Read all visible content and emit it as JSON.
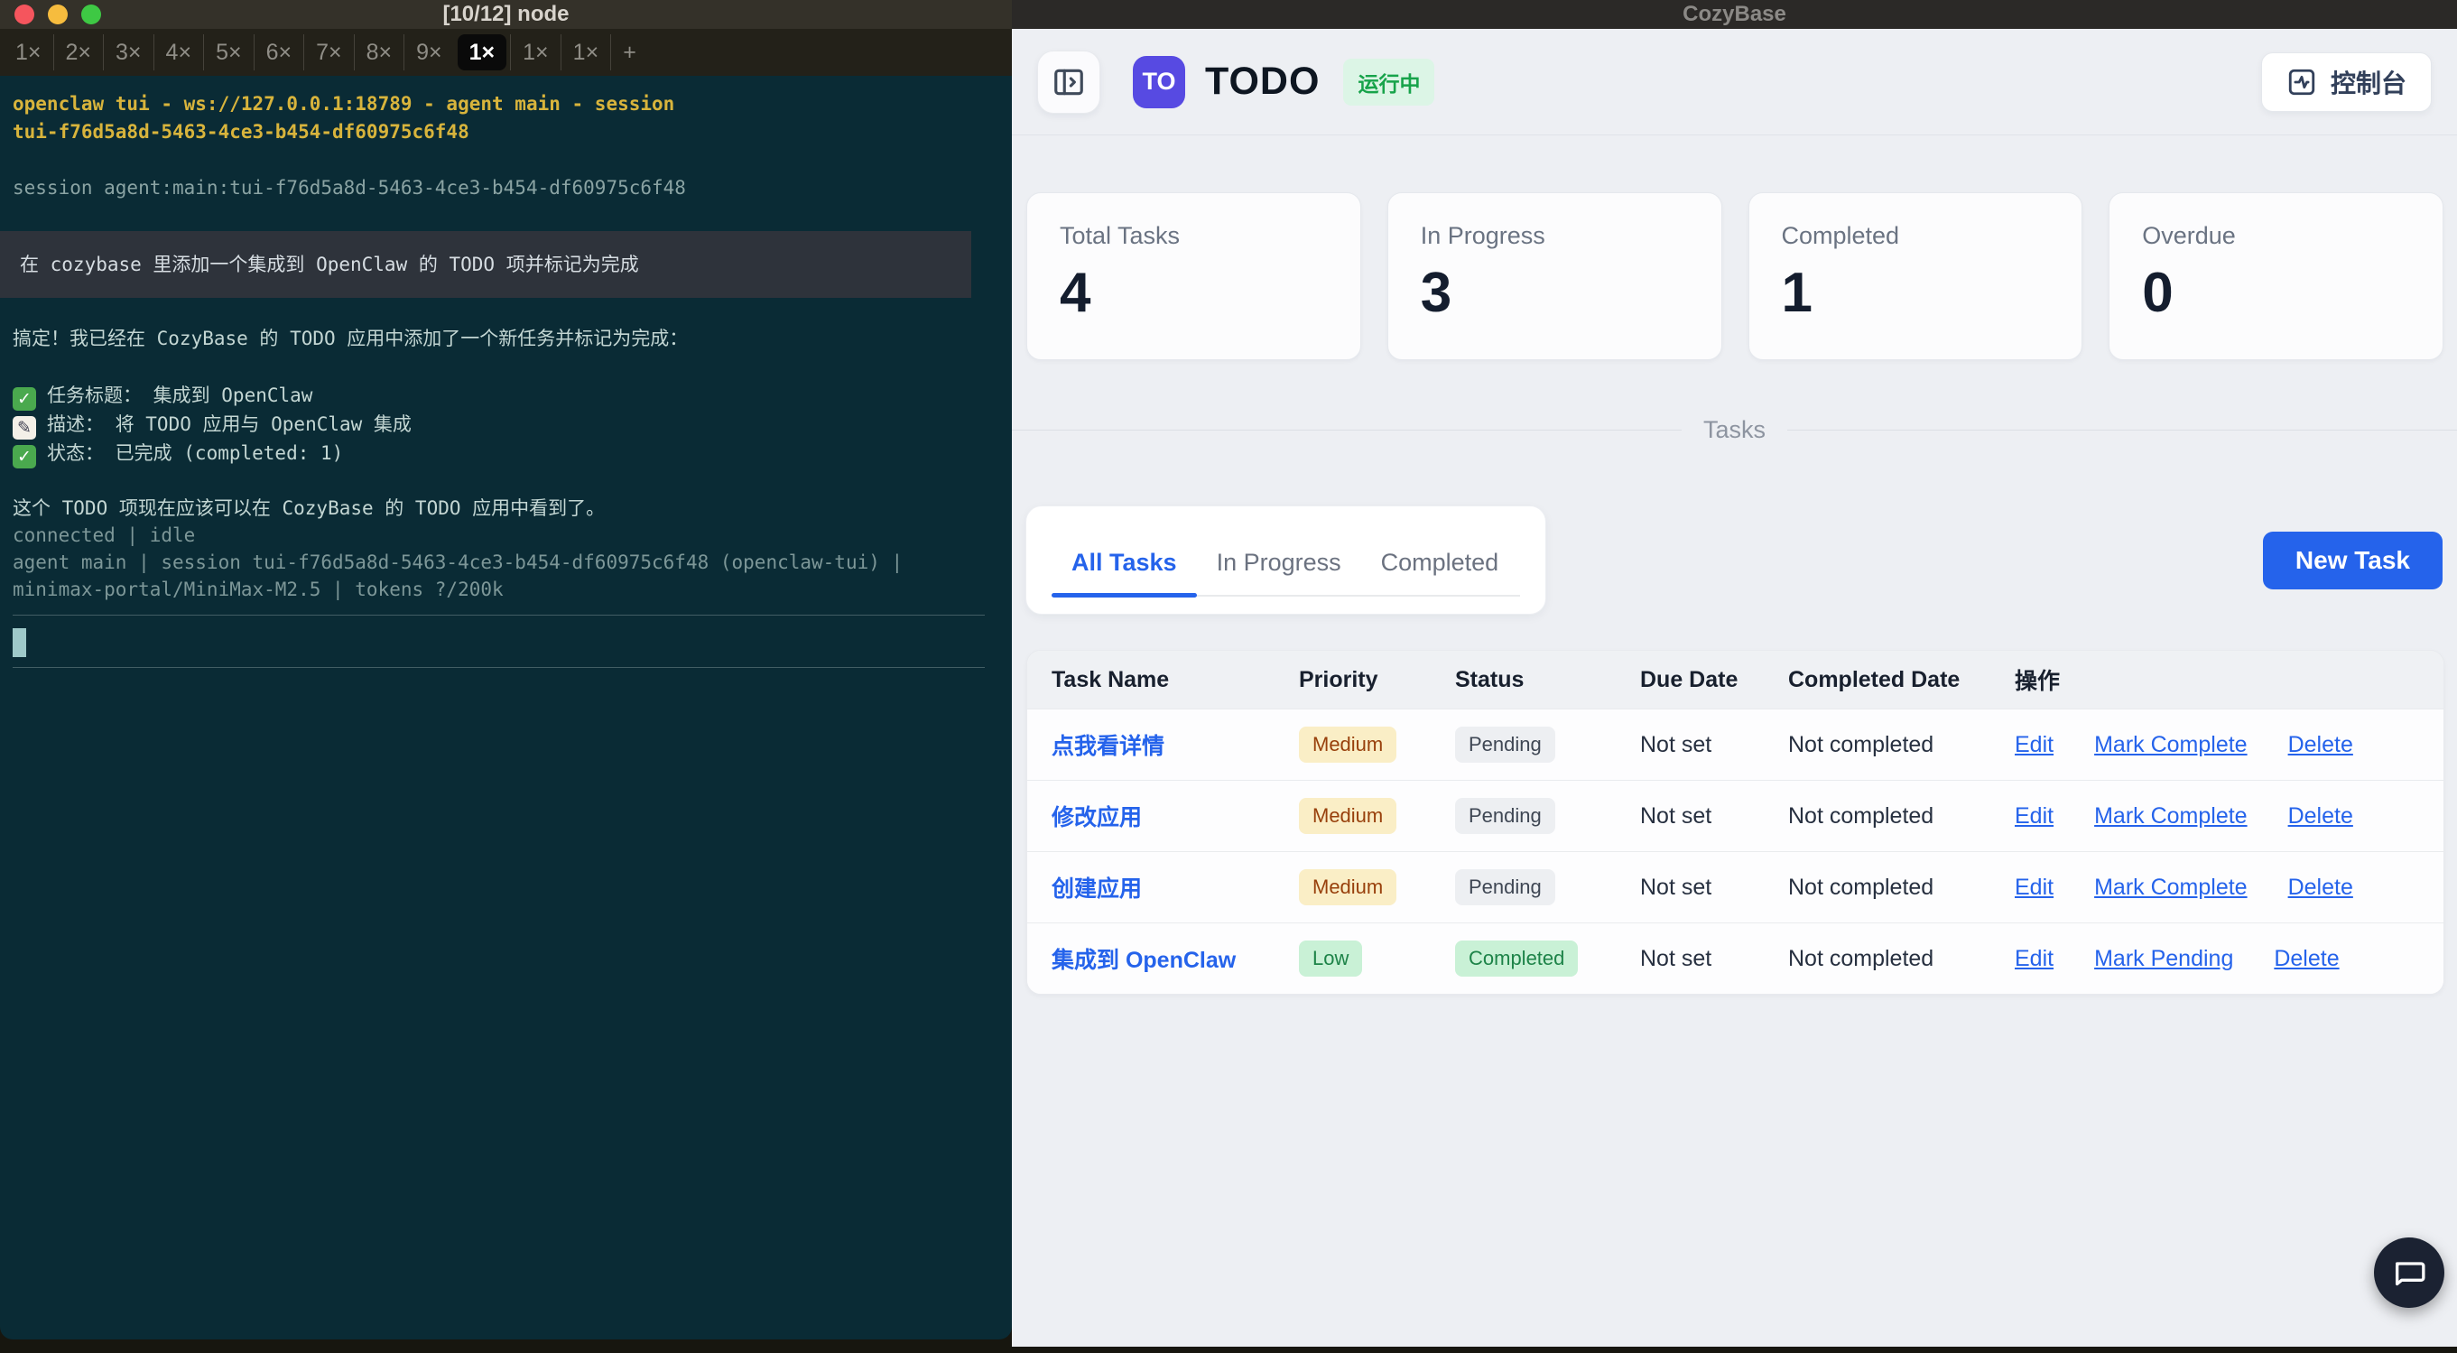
{
  "colors": {
    "accent_blue": "#2563eb",
    "logo_indigo": "#574ae2",
    "run_badge_bg": "#dcf5e6",
    "run_badge_text": "#17a34a",
    "priority_amber_bg": "#faeec6",
    "priority_amber_text": "#98400c",
    "status_gray_bg": "#edeff2",
    "status_gray_text": "#3f4754",
    "completed_green_bg": "#c9f1d6",
    "completed_green_text": "#1d8348",
    "terminal_bg": "#0a2b35",
    "terminal_yellow": "#d8b43c"
  },
  "terminal": {
    "window_title": "[10/12] node",
    "tabs": {
      "labels": [
        "1×",
        "2×",
        "3×",
        "4×",
        "5×",
        "6×",
        "7×",
        "8×",
        "9×",
        "1×",
        "1×",
        "1×"
      ],
      "active_index": 9,
      "new_tab_label": "+"
    },
    "lines": {
      "header_line1": "openclaw tui - ws://127.0.0.1:18789 - agent main - session",
      "header_line2": "tui-f76d5a8d-5463-4ce3-b454-df60975c6f48",
      "session_line": "session agent:main:tui-f76d5a8d-5463-4ce3-b454-df60975c6f48",
      "user_prompt": "在 cozybase 里添加一个集成到 OpenClaw 的 TODO 项并标记为完成",
      "reply_intro": "搞定！我已经在 CozyBase 的 TODO 应用中添加了一个新任务并标记为完成：",
      "bullets": [
        {
          "icon": "✅",
          "label": "任务标题： 集成到 OpenClaw"
        },
        {
          "icon": "📝",
          "label": "描述： 将 TODO 应用与 OpenClaw 集成"
        },
        {
          "icon": "✅",
          "label": "状态： 已完成 (completed: 1)"
        }
      ],
      "reply_outro": "这个 TODO 项现在应该可以在 CozyBase 的 TODO 应用中看到了。",
      "status1": "connected | idle",
      "status2": "agent main | session tui-f76d5a8d-5463-4ce3-b454-df60975c6f48 (openclaw-tui) |",
      "status3": "minimax-portal/MiniMax-M2.5 | tokens ?/200k"
    }
  },
  "app": {
    "window_title": "CozyBase",
    "logo_monogram": "TO",
    "app_name": "TODO",
    "status_badge": "运行中",
    "console_button": "控制台",
    "stats": [
      {
        "label": "Total Tasks",
        "value": "4"
      },
      {
        "label": "In Progress",
        "value": "3"
      },
      {
        "label": "Completed",
        "value": "1"
      },
      {
        "label": "Overdue",
        "value": "0"
      }
    ],
    "tasks_divider_label": "Tasks",
    "tabs": {
      "labels": [
        "All Tasks",
        "In Progress",
        "Completed"
      ],
      "active_index": 0
    },
    "new_task_button": "New Task",
    "table": {
      "headers": [
        "Task Name",
        "Priority",
        "Status",
        "Due Date",
        "Completed Date",
        "操作"
      ],
      "rows": [
        {
          "name": "点我看详情",
          "priority": "Medium",
          "status": "Pending",
          "due": "Not set",
          "completed_date": "Not completed",
          "actions": [
            "Edit",
            "Mark Complete",
            "Delete"
          ]
        },
        {
          "name": "修改应用",
          "priority": "Medium",
          "status": "Pending",
          "due": "Not set",
          "completed_date": "Not completed",
          "actions": [
            "Edit",
            "Mark Complete",
            "Delete"
          ]
        },
        {
          "name": "创建应用",
          "priority": "Medium",
          "status": "Pending",
          "due": "Not set",
          "completed_date": "Not completed",
          "actions": [
            "Edit",
            "Mark Complete",
            "Delete"
          ]
        },
        {
          "name": "集成到 OpenClaw",
          "priority": "Low",
          "status": "Completed",
          "due": "Not set",
          "completed_date": "Not completed",
          "actions": [
            "Edit",
            "Mark Pending",
            "Delete"
          ]
        }
      ]
    }
  }
}
